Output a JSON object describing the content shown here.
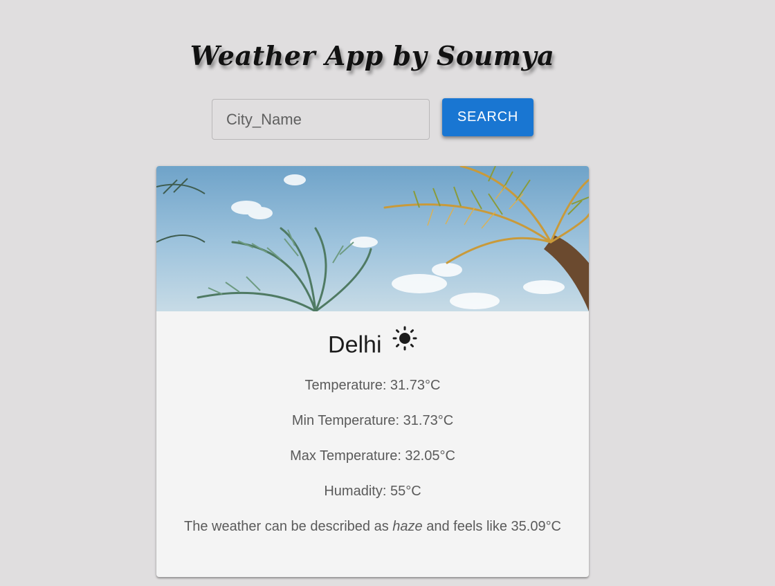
{
  "app": {
    "title": "Weather App by Soumya"
  },
  "search": {
    "placeholder": "City_Name",
    "button_label": "SEARCH"
  },
  "card": {
    "image": "palm-trees-sky",
    "city": "Delhi",
    "weather_icon": "sun-icon",
    "temperature": "Temperature: 31.73°C",
    "min_temperature": "Min Temperature: 31.73°C",
    "max_temperature": "Max Temperature: 32.05°C",
    "humidity": "Humadity: 55°C",
    "description_prefix": "The weather can be described as",
    "description_value": "haze",
    "description_suffix": "and feels like 35.09°C"
  },
  "colors": {
    "background": "#e0dedf",
    "accent": "#1976d2",
    "card": "#f4f4f4"
  }
}
